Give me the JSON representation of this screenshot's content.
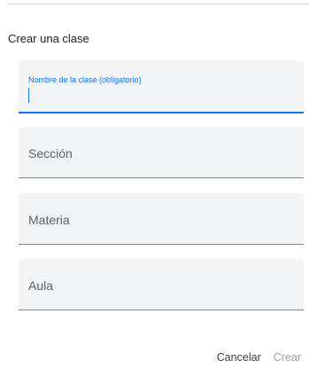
{
  "dialog": {
    "title": "Crear una clase",
    "fields": {
      "class_name": {
        "label": "Nombre de la clase (obligatorio)",
        "value": ""
      },
      "section": {
        "placeholder": "Sección"
      },
      "subject": {
        "placeholder": "Materia"
      },
      "room": {
        "placeholder": "Aula"
      }
    },
    "actions": {
      "cancel_label": "Cancelar",
      "create_label": "Crear"
    }
  },
  "colors": {
    "accent": "#1a73e8",
    "field_bg": "#f1f3f4",
    "disabled_text": "#9aa0a6"
  }
}
